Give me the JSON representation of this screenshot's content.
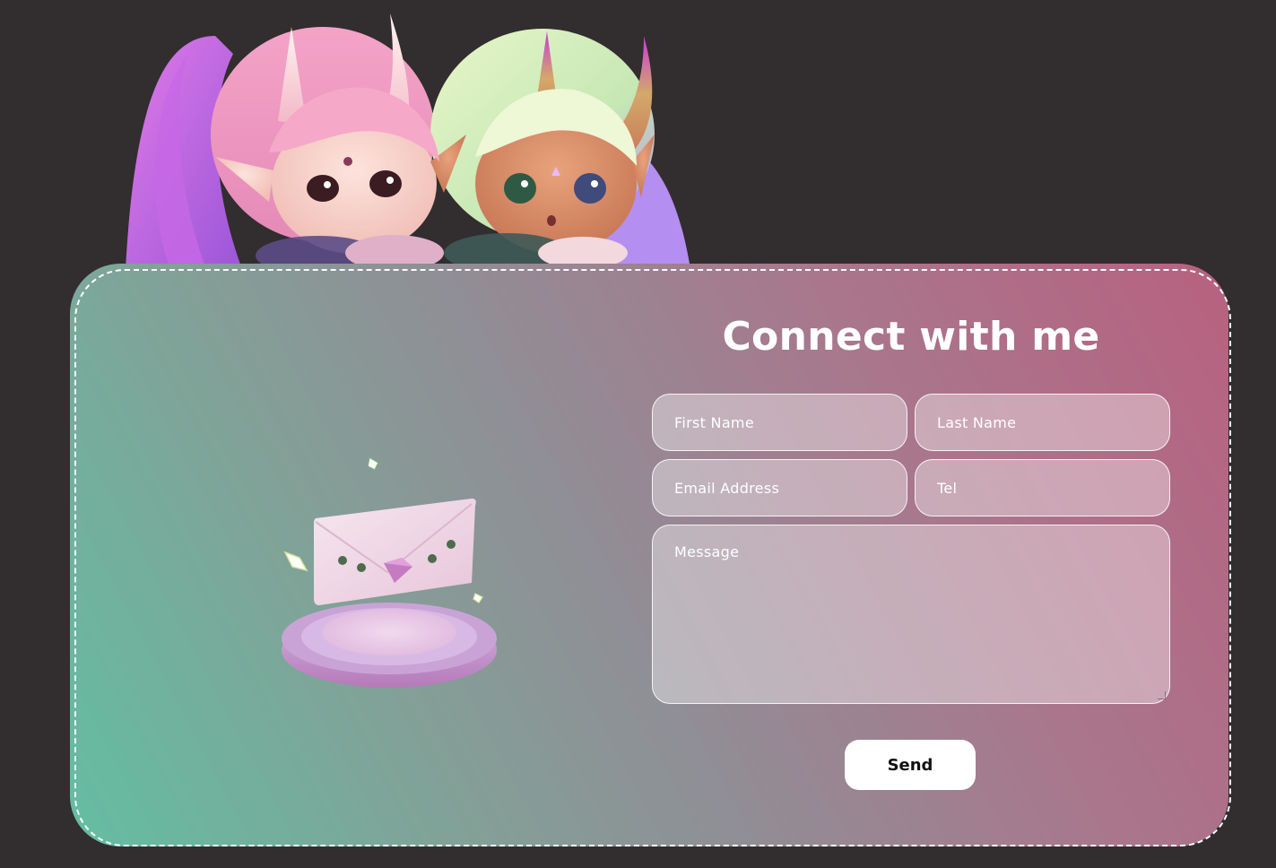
{
  "contact": {
    "title": "Connect with me",
    "fields": {
      "first_name": {
        "placeholder": "First Name",
        "value": ""
      },
      "last_name": {
        "placeholder": "Last Name",
        "value": ""
      },
      "email": {
        "placeholder": "Email Address",
        "value": ""
      },
      "tel": {
        "placeholder": "Tel",
        "value": ""
      },
      "message": {
        "placeholder": "Message",
        "value": ""
      }
    },
    "send_label": "Send"
  },
  "images": {
    "characters": "chibi-oni-characters-illustration",
    "envelope": "envelope-on-pedestal-illustration"
  },
  "colors": {
    "page_background": "#322d2e",
    "gradient_start": "#63bea2",
    "gradient_mid": "#8f8f96",
    "gradient_end": "#b7617f",
    "button_background": "#ffffff"
  }
}
